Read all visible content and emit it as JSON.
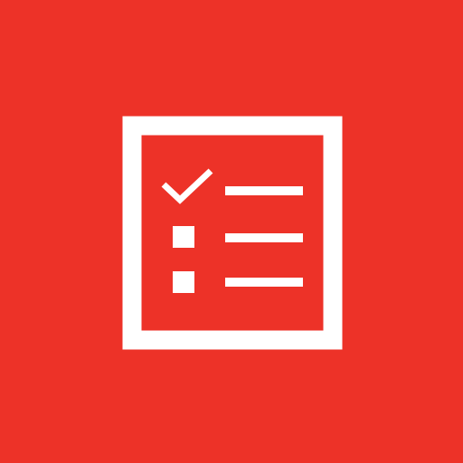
{
  "icon": {
    "name": "checklist-icon",
    "colors": {
      "background": "#ed3228",
      "foreground": "#ffffff"
    },
    "items": [
      {
        "marker": "checkmark",
        "checked": true
      },
      {
        "marker": "square",
        "checked": false
      },
      {
        "marker": "square",
        "checked": false
      }
    ]
  }
}
